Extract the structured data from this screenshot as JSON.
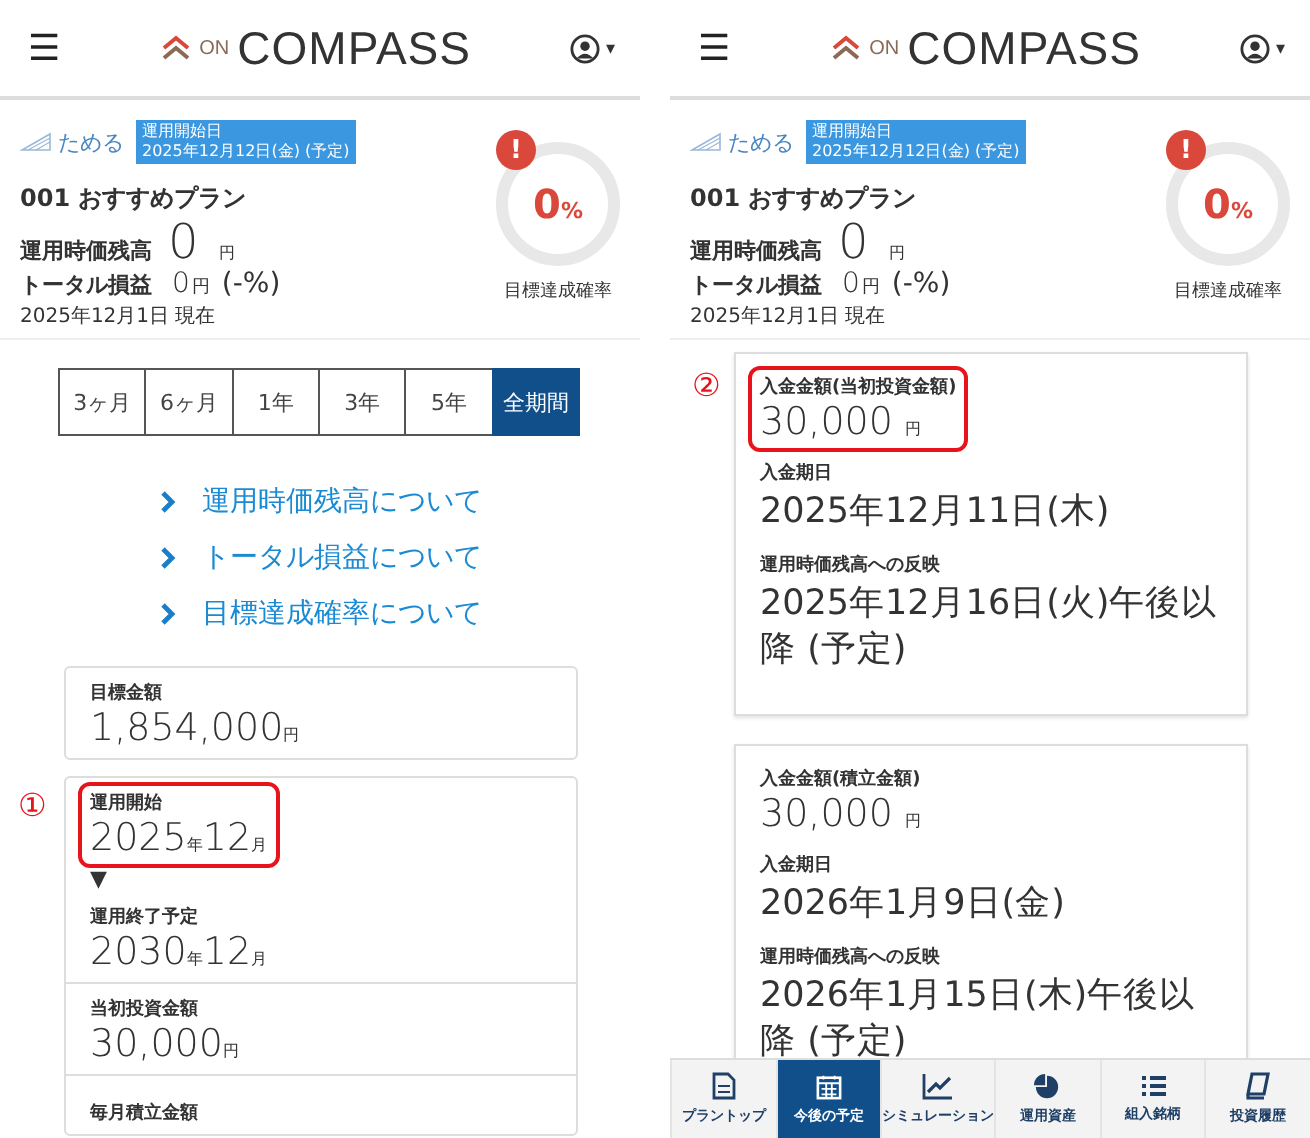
{
  "left_screen": {
    "header": {
      "menu": "☰",
      "logo_small": "ON",
      "logo_large": "COMPASS",
      "caret": "▾"
    },
    "summary": {
      "category": "ためる",
      "tag_lines": [
        "運用開始日",
        "2025年12月12日(金) (予定)"
      ],
      "plan": "001 おすすめプラン",
      "balance_label": "運用時価残高",
      "balance_value": "0",
      "balance_unit": "円",
      "pnl_label": "トータル損益",
      "pnl_value": "0",
      "pnl_unit": "円",
      "pnl_rate": "(-%)",
      "as_of": "2025年12月1日 現在",
      "alert": "!",
      "gauge_value": "0",
      "gauge_unit": "%",
      "gauge_label": "目標達成確率"
    },
    "period_tabs": [
      {
        "label": "3ヶ月",
        "selected": false
      },
      {
        "label": "6ヶ月",
        "selected": false
      },
      {
        "label": "1年",
        "selected": false
      },
      {
        "label": "3年",
        "selected": false
      },
      {
        "label": "5年",
        "selected": false
      },
      {
        "label": "全期間",
        "selected": true
      }
    ],
    "links": [
      "運用時価残高について",
      "トータル損益について",
      "目標達成確率について"
    ],
    "cards": [
      {
        "items": [
          {
            "label": "目標金額",
            "value_parts": [
              {
                "text": "1,854,000",
                "kind": "num"
              },
              {
                "text": "円",
                "kind": "unit"
              }
            ]
          }
        ]
      },
      {
        "items": [
          {
            "label": "運用開始",
            "marker": "①",
            "highlighted": true,
            "arrow": "▼",
            "value_parts": [
              {
                "text": "2025",
                "kind": "num"
              },
              {
                "text": "年",
                "kind": "unit"
              },
              {
                "text": "12",
                "kind": "num"
              },
              {
                "text": "月",
                "kind": "unit"
              }
            ]
          },
          {
            "label": "運用終了予定",
            "highlighted": false,
            "value_parts": [
              {
                "text": "2030",
                "kind": "num"
              },
              {
                "text": "年",
                "kind": "unit"
              },
              {
                "text": "12",
                "kind": "num"
              },
              {
                "text": "月",
                "kind": "unit"
              }
            ]
          },
          {
            "label": "当初投資金額",
            "highlighted": false,
            "value_parts": [
              {
                "text": "30,000",
                "kind": "num"
              },
              {
                "text": "円",
                "kind": "unit"
              }
            ]
          },
          {
            "label": "毎月積立金額",
            "highlighted": false
          }
        ]
      }
    ]
  },
  "right_screen": {
    "header": {
      "menu": "☰",
      "logo_small": "ON",
      "logo_large": "COMPASS",
      "caret": "▾"
    },
    "summary": {
      "category": "ためる",
      "tag_lines": [
        "運用開始日",
        "2025年12月12日(金) (予定)"
      ],
      "plan": "001 おすすめプラン",
      "balance_label": "運用時価残高",
      "balance_value": "0",
      "balance_unit": "円",
      "pnl_label": "トータル損益",
      "pnl_value": "0",
      "pnl_unit": "円",
      "pnl_rate": "(-%)",
      "as_of": "2025年12月1日 現在",
      "alert": "!",
      "gauge_value": "0",
      "gauge_unit": "%",
      "gauge_label": "目標達成確率"
    },
    "deposits": [
      {
        "amount_label": "入金金額(当初投資金額)",
        "amount": "30,000",
        "amount_unit": "円",
        "marker": "②",
        "highlighted": true,
        "date_label": "入金期日",
        "date": "2025年12月11日(木)",
        "reflect_label": "運用時価残高への反映",
        "reflect": "2025年12月16日(火)午後以降 (予定)"
      },
      {
        "amount_label": "入金金額(積立金額)",
        "amount": "30,000",
        "amount_unit": "円",
        "highlighted": false,
        "date_label": "入金期日",
        "date": "2026年1月9日(金)",
        "reflect_label": "運用時価残高への反映",
        "reflect": "2026年1月15日(木)午後以降 (予定)"
      }
    ],
    "bottom_nav": [
      {
        "label": "プラントップ",
        "selected": false
      },
      {
        "label": "今後の予定",
        "selected": true
      },
      {
        "label": "シミュレーション",
        "selected": false
      },
      {
        "label": "運用資産",
        "selected": false
      },
      {
        "label": "組入銘柄",
        "selected": false
      },
      {
        "label": "投資履歴",
        "selected": false
      }
    ]
  }
}
